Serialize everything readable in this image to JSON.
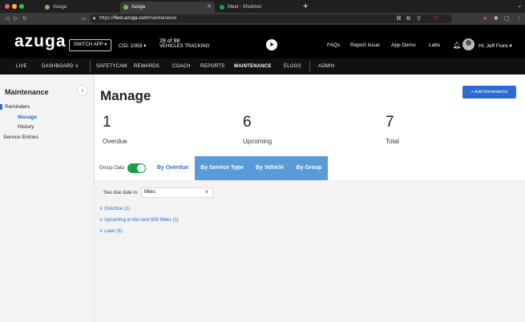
{
  "browser": {
    "tabs": [
      {
        "label": "Azuga"
      },
      {
        "label": "Azuga"
      },
      {
        "label": "Meet - Shotimel"
      }
    ],
    "new_tab": "+",
    "url_prefix": "https://",
    "url_host": "fleet.azuga.com",
    "url_path": "/maintenance"
  },
  "header": {
    "logo": "azuga",
    "switch_app": "SWITCH APP ▾",
    "cid": "CID: 1059 ▾",
    "vehicles_count": "28 of 88",
    "vehicles_label": "VEHICLES TRACKING",
    "links": [
      "FAQs",
      "Report Issue",
      "App Demo",
      "Labs"
    ],
    "user": "Hi, Jeff Fiore ▾"
  },
  "nav": {
    "items": [
      "LIVE",
      "DASHBOARD ∨",
      "SAFETYCAM",
      "REWARDS",
      "COACH",
      "REPORTS",
      "MAINTENANCE",
      "ELOGS",
      "ADMIN"
    ],
    "active": "MAINTENANCE"
  },
  "sidebar": {
    "title": "Maintenance",
    "collapse": "‹",
    "reminders": "Reminders",
    "manage": "Manage",
    "history": "History",
    "service_entries": "Service Entries"
  },
  "main": {
    "title": "Manage",
    "add_button": "+ Add Reminder(s)",
    "stats": [
      {
        "value": "1",
        "label": "Overdue"
      },
      {
        "value": "6",
        "label": "Upcoming"
      },
      {
        "value": "7",
        "label": "Total"
      }
    ],
    "group_data": "Group Data",
    "tabs": [
      "By Overdue",
      "By Service Type",
      "By Vehicle",
      "By Group"
    ],
    "active_tab": "By Overdue",
    "due_label": "See due date in:",
    "due_value": "Miles",
    "accordions": [
      "Overdue (1)",
      "Upcoming in the next 500 Miles (1)",
      "Later (6)"
    ]
  },
  "colors": {
    "accent": "#2b6cd3",
    "tab_bg": "#5b9ad8",
    "toggle_on": "#1aa04a",
    "header_bg": "#000000"
  }
}
